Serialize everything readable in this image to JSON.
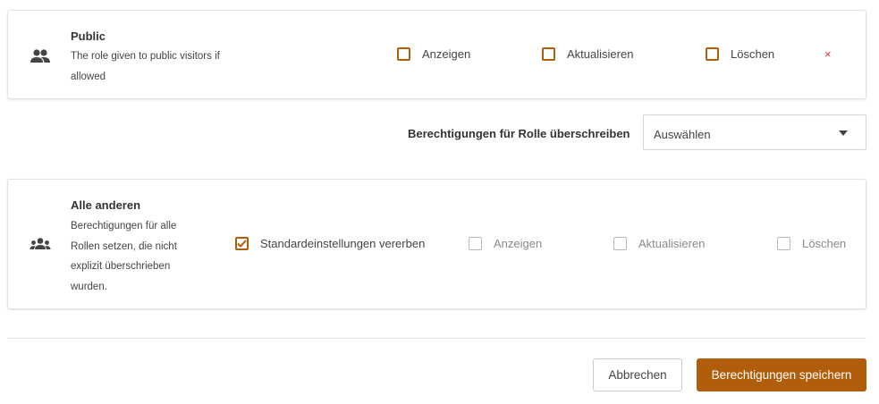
{
  "public_role": {
    "title": "Public",
    "description": "The role given to public visitors if allowed",
    "icon": "group-icon",
    "permissions": [
      {
        "label": "Anzeigen",
        "checked": false
      },
      {
        "label": "Aktualisieren",
        "checked": false
      },
      {
        "label": "Löschen",
        "checked": false
      }
    ],
    "remove_symbol": "×"
  },
  "override": {
    "label": "Berechtigungen für Rolle überschreiben",
    "select_value": "Auswählen"
  },
  "others_role": {
    "title": "Alle anderen",
    "description": "Berechtigungen für alle Rollen setzen, die nicht explizit überschrieben wurden.",
    "icon": "groups-icon",
    "inherit": {
      "label": "Standardeinstellungen vererben",
      "checked": true
    },
    "permissions": [
      {
        "label": "Anzeigen",
        "checked": false,
        "disabled": true
      },
      {
        "label": "Aktualisieren",
        "checked": false,
        "disabled": true
      },
      {
        "label": "Löschen",
        "checked": false,
        "disabled": true
      }
    ]
  },
  "actions": {
    "cancel_label": "Abbrechen",
    "save_label": "Berechtigungen speichern"
  },
  "colors": {
    "accent": "#b05e0b",
    "remove": "#d23a3a",
    "disabled": "#b8b8b8"
  }
}
